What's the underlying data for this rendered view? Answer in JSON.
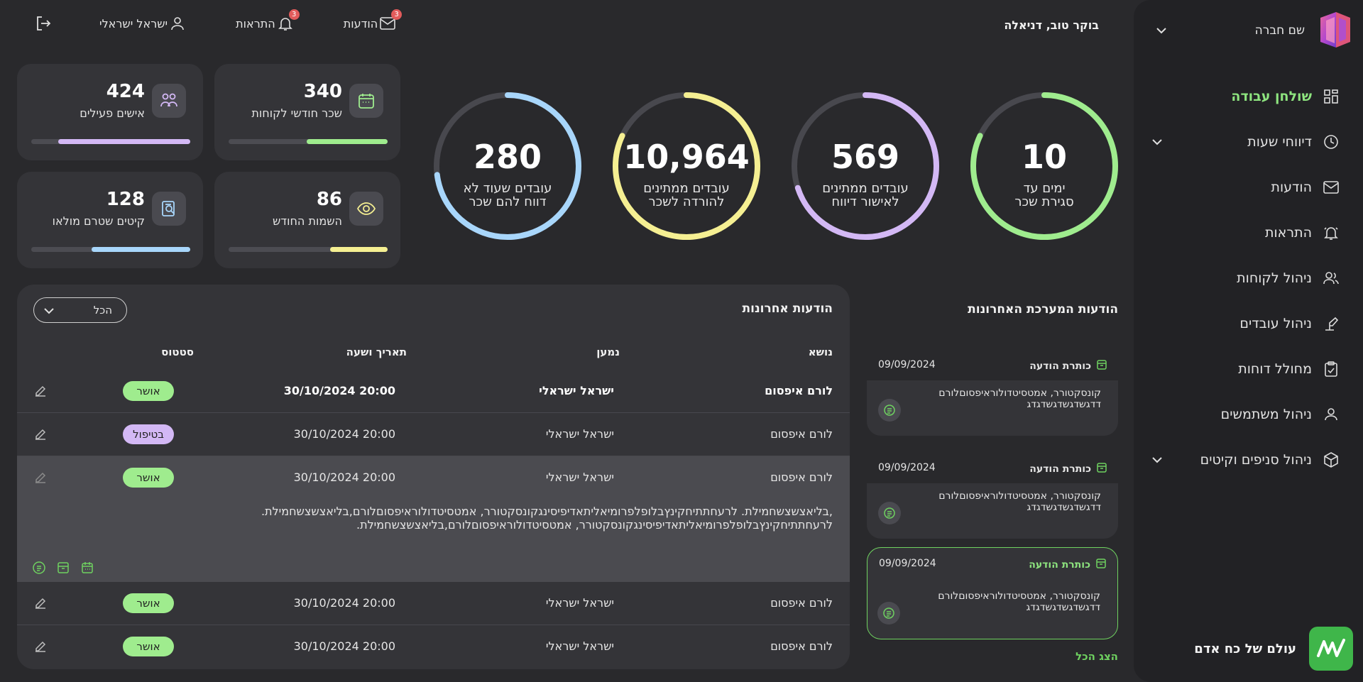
{
  "colors": {
    "accent_green": "#8ee57f",
    "green": "#9fec8e",
    "purple": "#d3b8f5",
    "yellow": "#f5ef92",
    "blue": "#a8d6fb",
    "badge_red": "#e25b5b",
    "status_approved": "#9fec8e",
    "status_processing": "#d3b8f5"
  },
  "sidebar": {
    "company_name": "שם חברה",
    "items": [
      {
        "label": "שולחן עבודה",
        "icon": "dashboard-icon",
        "active": true
      },
      {
        "label": "דיווחי שעות",
        "icon": "clock-icon",
        "has_chevron": true
      },
      {
        "label": "הודעות",
        "icon": "mail-icon"
      },
      {
        "label": "התראות",
        "icon": "bell-icon"
      },
      {
        "label": "ניהול לקוחות",
        "icon": "customers-icon"
      },
      {
        "label": "ניהול עובדים",
        "icon": "workers-icon"
      },
      {
        "label": "מחולל דוחות",
        "icon": "clipboard-icon"
      },
      {
        "label": "ניהול משתמשים",
        "icon": "users-icon"
      },
      {
        "label": "ניהול סניפים וקיטים",
        "icon": "box-icon",
        "has_chevron": true
      }
    ],
    "footer_name": "עולם של כח אדם"
  },
  "header": {
    "greeting": "בוקר טוב, דניאלה",
    "messages_label": "הודעות",
    "messages_count": "3",
    "alerts_label": "התראות",
    "alerts_count": "3",
    "user_name": "ישראל ישראלי"
  },
  "stats": [
    {
      "value": "340",
      "label": "שכר חודשי לקוחות",
      "icon": "calendar-icon",
      "fill": 0.51,
      "color": "#9fec8e"
    },
    {
      "value": "424",
      "label": "אישים פעילים",
      "icon": "people-icon",
      "fill": 0.83,
      "color": "#d3b8f5"
    },
    {
      "value": "86",
      "label": "השמות החודש",
      "icon": "eye-icon",
      "fill": 0.36,
      "color": "#f5ef92"
    },
    {
      "value": "128",
      "label": "קיטים שטרם מולאו",
      "icon": "search-doc-icon",
      "fill": 0.62,
      "color": "#a8d6fb"
    }
  ],
  "rings": [
    {
      "value": "10",
      "line1": "ימים עד",
      "line2": "סגירת שכר",
      "color": "#9fec8e",
      "fill": 0.82
    },
    {
      "value": "569",
      "line1": "עובדים ממתינים",
      "line2": "לאישור דיווח",
      "color": "#d3b8f5",
      "fill": 0.7
    },
    {
      "value": "10,964",
      "line1": "עובדים ממתינים",
      "line2": "להורדה לשכר",
      "color": "#f5ef92",
      "fill": 0.82
    },
    {
      "value": "280",
      "line1": "עובדים שעוד לא",
      "line2": "דווח להם שכר",
      "color": "#a8d6fb",
      "fill": 0.73
    }
  ],
  "system_messages": {
    "title": "הודעות המערכת האחרונות",
    "items": [
      {
        "title": "כותרת הודעה",
        "date": "09/09/2024",
        "text": "קונסקטורר, אמטסיטדולוראיפסוםלורם דדגשדגשדגשדגדג",
        "highlighted": false
      },
      {
        "title": "כותרת הודעה",
        "date": "09/09/2024",
        "text": "קונסקטורר, אמטסיטדולוראיפסוםלורם דדגשדגשדגשדגדג",
        "highlighted": false
      },
      {
        "title": "כותרת הודעה",
        "date": "09/09/2024",
        "text": "קונסקטורר, אמטסיטדולוראיפסוםלורם דדגשדגשדגשדגדג",
        "highlighted": true
      }
    ],
    "show_all": "הצג הכל"
  },
  "recent_messages": {
    "title": "הודעות אחרונות",
    "filter": "הכל",
    "columns": {
      "subject": "נושא",
      "sender": "נמען",
      "date": "תאריך ושעה",
      "status": "סטטוס"
    },
    "rows": [
      {
        "subject": "לורם איפסום",
        "sender": "ישראל ישראלי",
        "date": "30/10/2024 20:00",
        "status": "אושר",
        "status_color": "#9fec8e",
        "bold": true
      },
      {
        "subject": "לורם איפסום",
        "sender": "ישראל ישראלי",
        "date": "30/10/2024 20:00",
        "status": "בטיפול",
        "status_color": "#d3b8f5"
      },
      {
        "subject": "לורם איפסום",
        "sender": "ישראל ישראלי",
        "date": "30/10/2024 20:00",
        "status": "אושר",
        "status_color": "#9fec8e",
        "expanded": true,
        "description_line1": ",בליאצשצשחמילת. לרעחתתיחקינץבלופלפרומיאליתאדיפיסינגקונסקטורר, אמטסיטדולוראיפסוםלורם,בליאצשצשחמילת.",
        "description_line2": "לרעחתתיחקינץבלופלפרומיאליתאדיפיסינגקונסקטורר, אמטסיטדולוראיפסוםלורם,בליאצשצשחמילת."
      },
      {
        "subject": "לורם איפסום",
        "sender": "ישראל ישראלי",
        "date": "30/10/2024 20:00",
        "status": "אושר",
        "status_color": "#9fec8e"
      },
      {
        "subject": "לורם איפסום",
        "sender": "ישראל ישראלי",
        "date": "30/10/2024 20:00",
        "status": "אושר",
        "status_color": "#9fec8e"
      }
    ]
  }
}
